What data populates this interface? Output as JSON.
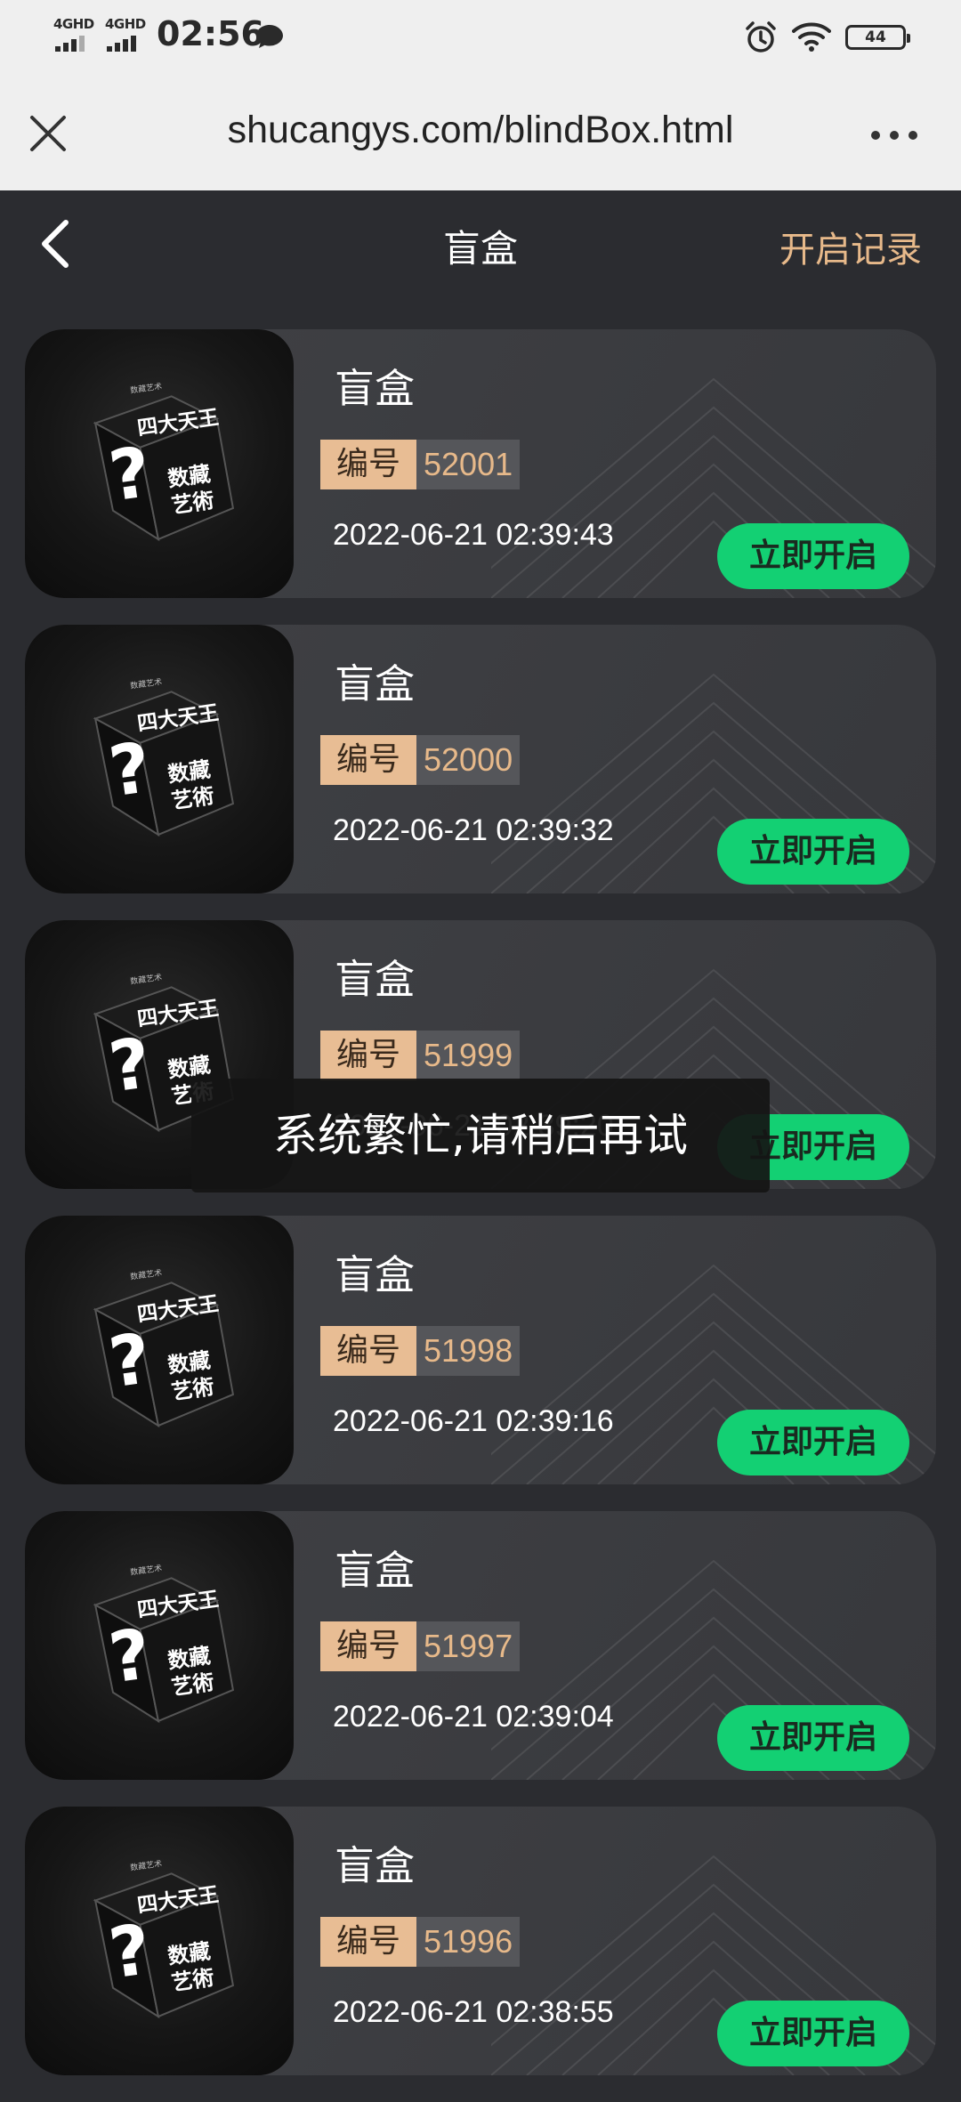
{
  "status_bar": {
    "signal_1": "4GHD",
    "signal_2": "4GHD",
    "time": "02:56",
    "battery": "44"
  },
  "browser": {
    "url": "shucangys.com/blindBox.html"
  },
  "header": {
    "title": "盲盒",
    "history_label": "开启记录"
  },
  "items": [
    {
      "title": "盲盒",
      "serial_label": "编号",
      "serial": "52001",
      "date": "2022-06-21 02:39:43",
      "button": "立即开启"
    },
    {
      "title": "盲盒",
      "serial_label": "编号",
      "serial": "52000",
      "date": "2022-06-21 02:39:32",
      "button": "立即开启"
    },
    {
      "title": "盲盒",
      "serial_label": "编号",
      "serial": "51999",
      "date": "2022-06-21 02:39:20",
      "button": "立即开启"
    },
    {
      "title": "盲盒",
      "serial_label": "编号",
      "serial": "51998",
      "date": "2022-06-21 02:39:16",
      "button": "立即开启"
    },
    {
      "title": "盲盒",
      "serial_label": "编号",
      "serial": "51997",
      "date": "2022-06-21 02:39:04",
      "button": "立即开启"
    },
    {
      "title": "盲盒",
      "serial_label": "编号",
      "serial": "51996",
      "date": "2022-06-21 02:38:55",
      "button": "立即开启"
    }
  ],
  "thumb": {
    "top_text": "数藏艺术",
    "face_text": "四大天王",
    "side_text": "数藏",
    "side_text_2": "艺術",
    "mark": "?"
  },
  "toast": {
    "message": "系统繁忙,请稍后再试"
  },
  "colors": {
    "accent_green": "#13d073",
    "accent_gold": "#e7b98a",
    "background": "#2b2c30"
  }
}
